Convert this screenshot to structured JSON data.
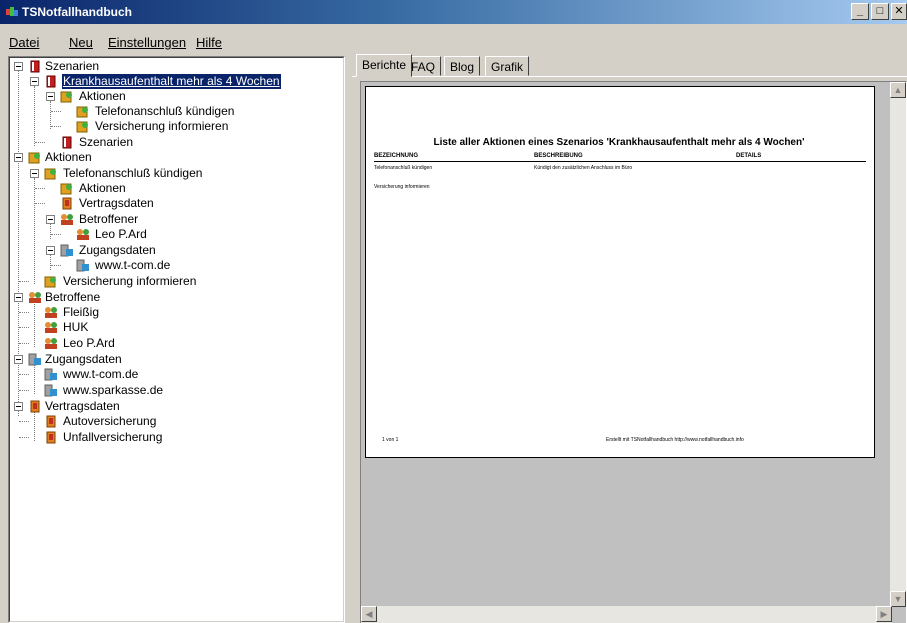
{
  "window": {
    "title": "TSNotfallhandbuch"
  },
  "menu": [
    {
      "label": "Datei"
    },
    {
      "label": "Neu"
    },
    {
      "label": "Einstellungen"
    },
    {
      "label": "Hilfe"
    }
  ],
  "tree": {
    "nodes": [
      {
        "label": "Szenarien"
      },
      {
        "label": "Krankhausaufenthalt mehr als 4 Wochen"
      },
      {
        "label": "Aktionen"
      },
      {
        "label": "Telefonanschluß kündigen"
      },
      {
        "label": "Versicherung informieren"
      },
      {
        "label": "Szenarien"
      },
      {
        "label": "Aktionen"
      },
      {
        "label": "Telefonanschluß kündigen"
      },
      {
        "label": "Aktionen"
      },
      {
        "label": "Vertragsdaten"
      },
      {
        "label": "Betroffener"
      },
      {
        "label": "Leo P.Ard"
      },
      {
        "label": "Zugangsdaten"
      },
      {
        "label": "www.t-com.de"
      },
      {
        "label": "Versicherung informieren"
      },
      {
        "label": "Betroffene"
      },
      {
        "label": "Fleißig"
      },
      {
        "label": "HUK"
      },
      {
        "label": "Leo P.Ard"
      },
      {
        "label": "Zugangsdaten"
      },
      {
        "label": "www.t-com.de"
      },
      {
        "label": "www.sparkasse.de"
      },
      {
        "label": "Vertragsdaten"
      },
      {
        "label": "Autoversicherung"
      },
      {
        "label": "Unfallversicherung"
      }
    ]
  },
  "tabs": [
    {
      "label": "Berichte"
    },
    {
      "label": "FAQ"
    },
    {
      "label": "Blog"
    },
    {
      "label": "Grafik"
    }
  ],
  "report": {
    "title": "Liste aller Aktionen eines Szenarios  'Krankhausaufenthalt mehr als 4 Wochen'",
    "columns": [
      "BEZEICHNUNG",
      "BESCHREIBUNG",
      "DETAILS"
    ],
    "rows": [
      {
        "name": "Telefonanschluß kündigen",
        "desc": "Kündigt den zusätzlichen Anschluss im Büro",
        "details": ""
      },
      {
        "name": "Versicherung informieren",
        "desc": "",
        "details": ""
      }
    ],
    "footer_page": "1 von 1",
    "footer_credit": "Erstellt mit TSNotfallhandbuch http://www.notfallhandbuch.info"
  },
  "colors": {
    "titlebar": "#0a246a",
    "selection": "#0a246a",
    "face": "#d4d0c8"
  }
}
